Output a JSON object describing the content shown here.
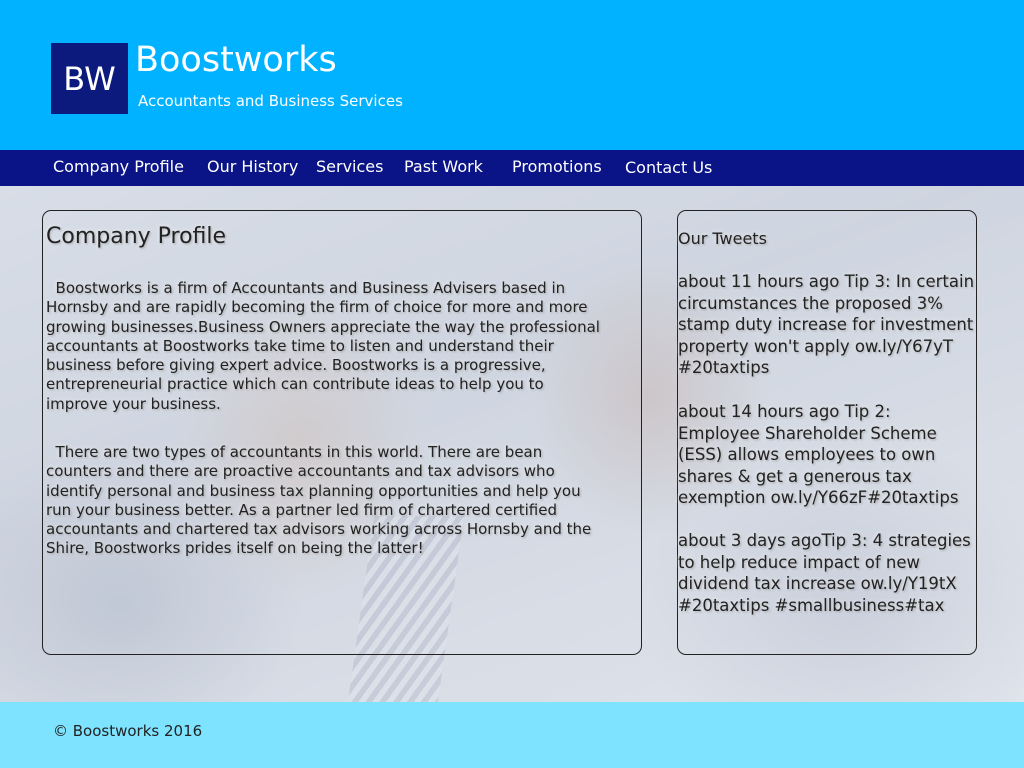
{
  "header": {
    "logo_text": "BW",
    "brand_name": "Boostworks",
    "tagline": "Accountants and Business Services"
  },
  "nav": {
    "items": [
      {
        "label": "Company Profile"
      },
      {
        "label": "Our History"
      },
      {
        "label": "Services"
      },
      {
        "label": "Past Work"
      },
      {
        "label": "Promotions"
      },
      {
        "label": "Contact Us"
      }
    ]
  },
  "main": {
    "title": "Company Profile",
    "paragraphs": [
      "  Boostworks is a firm of Accountants and Business Advisers based in Hornsby and are rapidly becoming the firm of choice for more and more growing businesses.Business Owners appreciate the way the professional accountants at Boostworks take time to listen and understand their business before giving expert advice. Boostworks is a progressive, entrepreneurial practice which can contribute ideas to help you to improve your business.",
      "  There are two types of accountants in this world. There are bean counters and there are proactive accountants and tax advisors who identify personal and business tax planning opportunities and help you run your business better. As a partner led firm of chartered certified accountants and chartered tax advisors working across Hornsby and the Shire, Boostworks prides itself on being the latter!"
    ]
  },
  "tweets": {
    "title": "Our Tweets",
    "items": [
      "about 11 hours ago Tip 3: In certain circumstances the proposed 3% stamp duty increase for investment property won't apply ow.ly/Y67yT #20taxtips",
      "about 14 hours ago Tip 2: Employee Shareholder Scheme (ESS) allows employees to own shares & get a generous tax exemption ow.ly/Y66zF#20taxtips",
      "about 3 days agoTip 3: 4 strategies to help reduce impact of new dividend tax increase ow.ly/Y19tX #20taxtips #smallbusiness#tax"
    ]
  },
  "footer": {
    "copyright": "© Boostworks 2016"
  },
  "colors": {
    "header_bg": "#00b2ff",
    "nav_bg": "#0a1486",
    "logo_bg": "#0c1a7e",
    "footer_bg": "#7de3ff"
  }
}
